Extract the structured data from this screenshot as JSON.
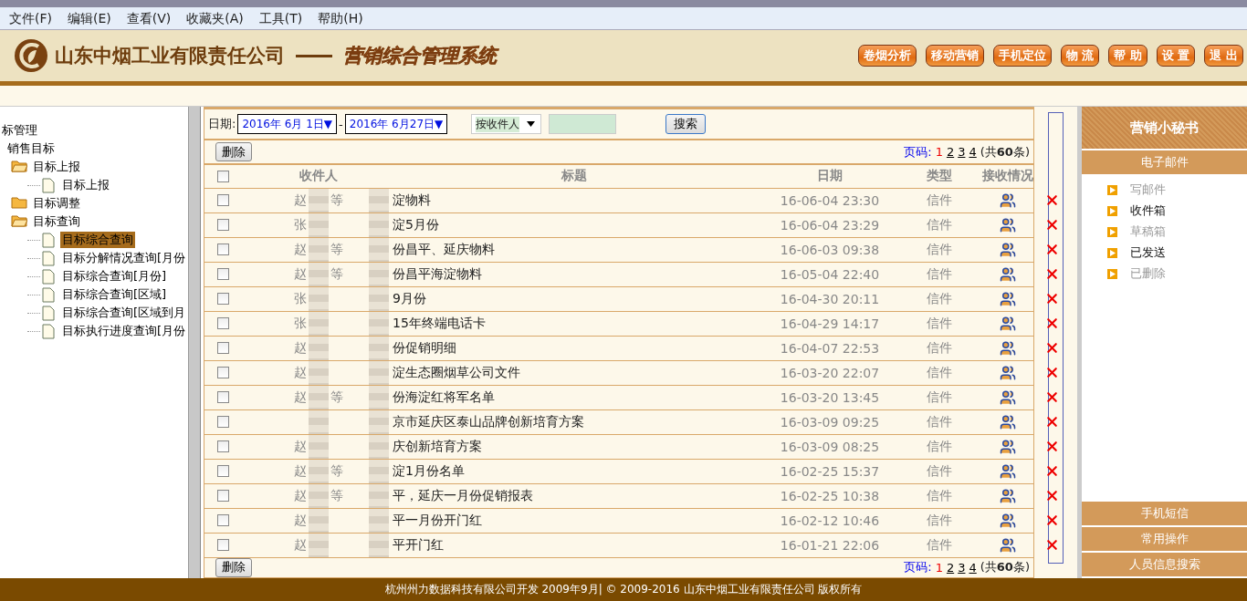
{
  "menu": [
    "文件(F)",
    "编辑(E)",
    "查看(V)",
    "收藏夹(A)",
    "工具(T)",
    "帮助(H)"
  ],
  "header": {
    "company": "山东中烟工业有限责任公司",
    "system": "营销综合管理系统",
    "buttons": [
      "卷烟分析",
      "移动营销",
      "手机定位",
      "物 流",
      "帮 助",
      "设 置",
      "退 出"
    ]
  },
  "tree": {
    "label": "标管理",
    "children": [
      {
        "label": "销售目标",
        "children": [
          {
            "label": "目标上报",
            "kind": "folder",
            "expanded": true,
            "children": [
              {
                "label": "目标上报",
                "kind": "page",
                "selected": false
              }
            ]
          },
          {
            "label": "目标调整",
            "kind": "folder",
            "expanded": false
          },
          {
            "label": "目标查询",
            "kind": "folder",
            "expanded": true,
            "children": [
              {
                "label": "目标综合查询",
                "kind": "page",
                "selected": true
              },
              {
                "label": "目标分解情况查询[月份",
                "kind": "page",
                "selected": false
              },
              {
                "label": "目标综合查询[月份]",
                "kind": "page",
                "selected": false
              },
              {
                "label": "目标综合查询[区域]",
                "kind": "page",
                "selected": false
              },
              {
                "label": "目标综合查询[区域到月",
                "kind": "page",
                "selected": false
              },
              {
                "label": "目标执行进度查询[月份",
                "kind": "page",
                "selected": false
              }
            ]
          }
        ]
      }
    ]
  },
  "filter": {
    "date_label": "日期:",
    "date_from": "2016年  6月  1日▼",
    "separator": "-",
    "date_to": "2016年  6月27日▼",
    "search_by": "按收件人",
    "search_button": "搜索"
  },
  "toolbar": {
    "delete_button": "删除",
    "pager_label": "页码:",
    "pages": [
      {
        "label": "1",
        "selected": true
      },
      {
        "label": "2",
        "selected": false
      },
      {
        "label": "3",
        "selected": false
      },
      {
        "label": "4",
        "selected": false
      }
    ],
    "total_prefix": "(共",
    "total": "60",
    "total_suffix": "条)"
  },
  "bottom_toolbar": {
    "delete_button": "删除",
    "pager_label": "页码:",
    "pages": [
      {
        "label": "1",
        "selected": true
      },
      {
        "label": "2",
        "selected": false
      },
      {
        "label": "3",
        "selected": false
      },
      {
        "label": "4",
        "selected": false
      }
    ],
    "total_prefix": "(共",
    "total": "60",
    "total_suffix": "条)"
  },
  "table": {
    "select_all_checked": false,
    "columns": [
      "收件人",
      "标题",
      "日期",
      "类型",
      "接收情况"
    ],
    "rows": [
      {
        "recipient": "赵",
        "recipient_end": "等",
        "title": "淀物料",
        "date": "16-06-04 23:30",
        "type": "信件",
        "checked": false
      },
      {
        "recipient": "张",
        "title": "淀5月份",
        "date": "16-06-04 23:29",
        "type": "信件",
        "checked": false
      },
      {
        "recipient": "赵",
        "recipient_end": "等",
        "title": "份昌平、延庆物料",
        "date": "16-06-03 09:38",
        "type": "信件",
        "checked": false
      },
      {
        "recipient": "赵",
        "recipient_end": "等",
        "title": "份昌平海淀物料",
        "date": "16-05-04 22:40",
        "type": "信件",
        "checked": false
      },
      {
        "recipient": "张",
        "title": "9月份",
        "date": "16-04-30 20:11",
        "type": "信件",
        "checked": false
      },
      {
        "recipient": "张",
        "title": "15年终端电话卡",
        "date": "16-04-29 14:17",
        "type": "信件",
        "checked": false
      },
      {
        "recipient": "赵",
        "title": "份促销明细",
        "date": "16-04-07 22:53",
        "type": "信件",
        "checked": false
      },
      {
        "recipient": "赵",
        "title": "淀生态圈烟草公司文件",
        "date": "16-03-20 22:07",
        "type": "信件",
        "checked": false
      },
      {
        "recipient": "赵",
        "recipient_end": "等",
        "title": "份海淀红将军名单",
        "date": "16-03-20 13:45",
        "type": "信件",
        "checked": false
      },
      {
        "title": "京市延庆区泰山品牌创新培育方案",
        "date": "16-03-09 09:25",
        "type": "信件",
        "checked": false
      },
      {
        "recipient": "赵",
        "title": "庆创新培育方案",
        "date": "16-03-09 08:25",
        "type": "信件",
        "checked": false
      },
      {
        "recipient": "赵",
        "recipient_end": "等",
        "title": "淀1月份名单",
        "date": "16-02-25 15:37",
        "type": "信件",
        "checked": false
      },
      {
        "recipient": "赵",
        "recipient_end": "等",
        "title": "平，延庆一月份促销报表",
        "date": "16-02-25 10:38",
        "type": "信件",
        "checked": false
      },
      {
        "recipient": "赵",
        "title": "平一月份开门红",
        "date": "16-02-12 10:46",
        "type": "信件",
        "checked": false
      },
      {
        "recipient": "赵",
        "title": "平开门红",
        "date": "16-01-21 22:06",
        "type": "信件",
        "checked": false
      }
    ]
  },
  "assistant": {
    "title": "营销小秘书",
    "sections": [
      {
        "label": "电子邮件",
        "expanded": true,
        "items": [
          {
            "label": "写邮件",
            "disabled": true
          },
          {
            "label": "收件箱",
            "disabled": false
          },
          {
            "label": "草稿箱",
            "disabled": true
          },
          {
            "label": "已发送",
            "disabled": false
          },
          {
            "label": "已删除",
            "disabled": true
          }
        ]
      },
      {
        "label": "手机短信",
        "expanded": false
      },
      {
        "label": "常用操作",
        "expanded": false
      },
      {
        "label": "人员信息搜索",
        "expanded": false
      }
    ]
  },
  "footer": "杭州州力数据科技有限公司开发 2009年9月| © 2009-2016 山东中烟工业有限责任公司 版权所有"
}
